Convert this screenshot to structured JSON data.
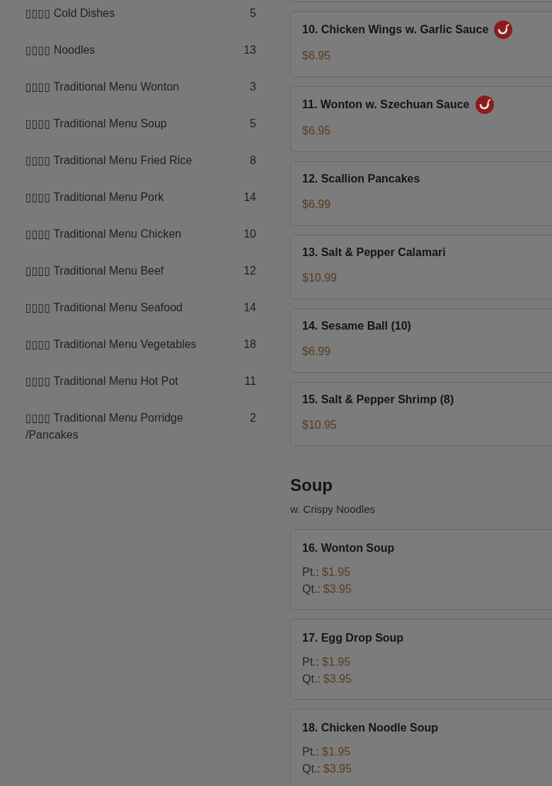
{
  "sidebar": {
    "categories": [
      {
        "label": "▯▯▯▯ Cold Dishes",
        "count": "5"
      },
      {
        "label": "▯▯▯▯ Noodles",
        "count": "13"
      },
      {
        "label": "▯▯▯▯ Traditional Menu Wonton",
        "count": "3"
      },
      {
        "label": "▯▯▯▯ Traditional Menu Soup",
        "count": "5"
      },
      {
        "label": "▯▯▯▯ Traditional Menu Fried Rice",
        "count": "8"
      },
      {
        "label": "▯▯▯▯ Traditional Menu Pork",
        "count": "14"
      },
      {
        "label": "▯▯▯▯ Traditional Menu Chicken",
        "count": "10"
      },
      {
        "label": "▯▯▯▯ Traditional Menu Beef",
        "count": "12"
      },
      {
        "label": "▯▯▯▯ Traditional Menu Seafood",
        "count": "14"
      },
      {
        "label": "▯▯▯▯ Traditional Menu Vegetables",
        "count": "18"
      },
      {
        "label": "▯▯▯▯ Traditional Menu Hot Pot",
        "count": "11"
      },
      {
        "label": "▯▯▯▯ Traditional Menu Porridge /Pancakes",
        "count": "2"
      }
    ]
  },
  "menu_sections": [
    {
      "items": [
        {
          "title": "10. Chicken Wings w. Garlic Sauce",
          "spicy": true,
          "prices": [
            {
              "amount": "$6.95"
            }
          ]
        },
        {
          "title": "11. Wonton w. Szechuan Sauce",
          "spicy": true,
          "prices": [
            {
              "amount": "$6.95"
            }
          ]
        },
        {
          "title": "12. Scallion Pancakes",
          "spicy": false,
          "prices": [
            {
              "amount": "$6.99"
            }
          ]
        },
        {
          "title": "13. Salt & Pepper Calamari",
          "spicy": false,
          "prices": [
            {
              "amount": "$10.99"
            }
          ]
        },
        {
          "title": "14. Sesame Ball (10)",
          "spicy": false,
          "prices": [
            {
              "amount": "$6.99"
            }
          ]
        },
        {
          "title": "15. Salt & Pepper Shrimp (8)",
          "spicy": false,
          "prices": [
            {
              "amount": "$10.95"
            }
          ]
        }
      ]
    },
    {
      "title": "Soup",
      "subtitle": "w. Crispy Noodles",
      "items": [
        {
          "title": "16. Wonton Soup",
          "spicy": false,
          "prices": [
            {
              "size": "Pt.:",
              "amount": "$1.95"
            },
            {
              "size": "Qt.:",
              "amount": "$3.95"
            }
          ]
        },
        {
          "title": "17. Egg Drop Soup",
          "spicy": false,
          "prices": [
            {
              "size": "Pt.:",
              "amount": "$1.95"
            },
            {
              "size": "Qt.:",
              "amount": "$3.95"
            }
          ]
        },
        {
          "title": "18. Chicken Noodle Soup",
          "spicy": false,
          "prices": [
            {
              "size": "Pt.:",
              "amount": "$1.95"
            },
            {
              "size": "Qt.:",
              "amount": "$3.95"
            }
          ]
        }
      ]
    }
  ]
}
